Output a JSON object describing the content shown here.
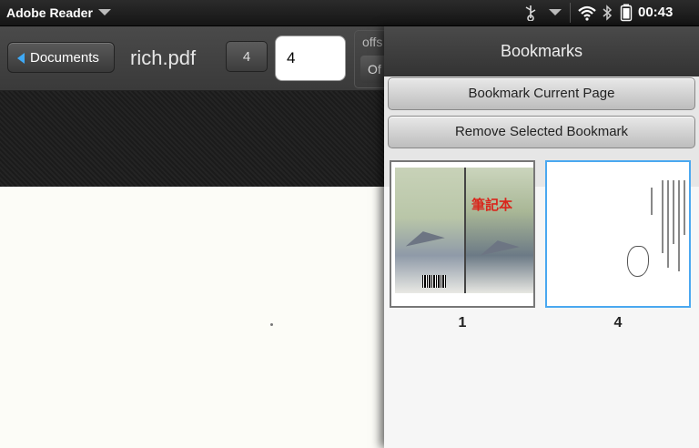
{
  "status_bar": {
    "app_name": "Adobe Reader",
    "time": "00:43",
    "icons": [
      "app-menu-arrow-icon",
      "usb-icon",
      "notifications-arrow-icon",
      "wifi-icon",
      "bluetooth-icon",
      "battery-icon"
    ]
  },
  "toolbar": {
    "back_button_label": "Documents",
    "file_title": "rich.pdf",
    "page_badge": "4",
    "page_input_value": "4",
    "offset_label": "offs",
    "offset_toggle": "Of"
  },
  "bookmarks_panel": {
    "title": "Bookmarks",
    "bookmark_current_label": "Bookmark Current Page",
    "remove_selected_label": "Remove Selected Bookmark",
    "bookmarks": [
      {
        "page": "1",
        "selected": false
      },
      {
        "page": "4",
        "selected": true
      }
    ],
    "thumb1_cover_title": "筆記本"
  },
  "colors": {
    "accent": "#3fa9f5",
    "selection_border": "#4aa8f0"
  }
}
